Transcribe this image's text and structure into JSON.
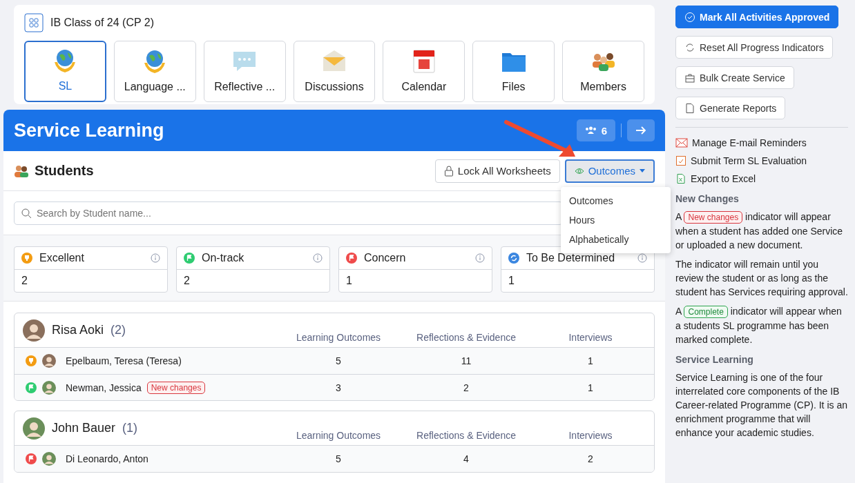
{
  "class_card": {
    "title": "IB Class of 24 (CP 2)",
    "tiles": [
      {
        "label": "SL",
        "kind": "globe",
        "selected": true
      },
      {
        "label": "Language ...",
        "kind": "globe",
        "selected": false
      },
      {
        "label": "Reflective ...",
        "kind": "chat",
        "selected": false
      },
      {
        "label": "Discussions",
        "kind": "mail",
        "selected": false
      },
      {
        "label": "Calendar",
        "kind": "calendar",
        "selected": false
      },
      {
        "label": "Files",
        "kind": "folder",
        "selected": false
      },
      {
        "label": "Members",
        "kind": "people",
        "selected": false
      }
    ]
  },
  "panel": {
    "title": "Service Learning",
    "member_count": "6"
  },
  "students_bar": {
    "title": "Students",
    "lock_button": "Lock All Worksheets",
    "sort_button": {
      "label": "Outcomes",
      "expanded": true
    },
    "sort_menu": [
      {
        "label": "Outcomes"
      },
      {
        "label": "Hours"
      },
      {
        "label": "Alphabetically"
      }
    ]
  },
  "search": {
    "placeholder": "Search by Student name..."
  },
  "summary": [
    {
      "label": "Excellent",
      "kind": "excellent",
      "count": "2"
    },
    {
      "label": "On-track",
      "kind": "on-track",
      "count": "2"
    },
    {
      "label": "Concern",
      "kind": "concern",
      "count": "1"
    },
    {
      "label": "To Be Determined",
      "kind": "tbd",
      "count": "1"
    }
  ],
  "groups": [
    {
      "teacher": "Risa Aoki",
      "count": "(2)",
      "columns": [
        "Learning Outcomes",
        "Reflections & Evidence",
        "Interviews"
      ],
      "students": [
        {
          "name": "Epelbaum, Teresa (Teresa)",
          "kind": "excellent",
          "values": [
            "5",
            "11",
            "1"
          ]
        },
        {
          "name": "Newman, Jessica",
          "kind": "on-track",
          "tag": "New changes",
          "values": [
            "3",
            "2",
            "1"
          ]
        }
      ]
    },
    {
      "teacher": "John Bauer",
      "count": "(1)",
      "columns": [
        "Learning Outcomes",
        "Reflections & Evidence",
        "Interviews"
      ],
      "students": [
        {
          "name": "Di Leonardo, Anton",
          "kind": "concern",
          "values": [
            "5",
            "4",
            "2"
          ]
        }
      ]
    }
  ],
  "sidebar": {
    "buttons": [
      {
        "label": "Mark All Activities Approved",
        "kind": "primary"
      },
      {
        "label": "Reset All Progress Indicators",
        "kind": "reset"
      },
      {
        "label": "Bulk Create Service",
        "kind": "briefcase"
      },
      {
        "label": "Generate Reports",
        "kind": "pdf"
      }
    ],
    "links": [
      {
        "label": "Manage E-mail Reminders",
        "kind": "mail"
      },
      {
        "label": "Submit Term SL Evaluation",
        "kind": "evaluation"
      },
      {
        "label": "Export to Excel",
        "kind": "excel"
      }
    ],
    "sections": [
      {
        "heading": "New Changes",
        "paragraphs": [
          {
            "before": "A",
            "tag": "New changes",
            "kind": "new",
            "after": "indicator will appear when a student has added one Service or uploaded a new document."
          },
          {
            "before": "The indicator will remain until you review the student or as long as the student has Services requiring approval."
          },
          {
            "before": "A",
            "tag": "Complete",
            "kind": "complete",
            "after": "indicator will appear when a students SL programme has been marked complete."
          }
        ]
      },
      {
        "heading": "Service Learning",
        "paragraphs": [
          {
            "before": "Service Learning is one of the four interrelated core components of the IB Career-related Programme (CP). It is an enrichment programme that will enhance your academic studies."
          }
        ]
      }
    ]
  }
}
